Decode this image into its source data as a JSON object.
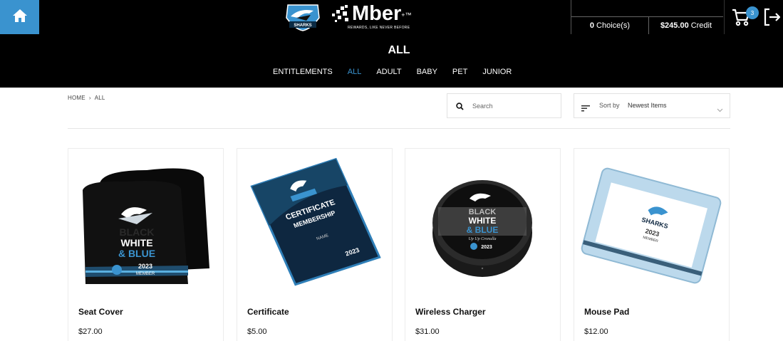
{
  "header": {
    "brand_name": "Mber",
    "brand_tm": "+™",
    "brand_tagline": "REWARDS, LIKE NEVER BEFORE",
    "shark_logo_text": "SHARKS",
    "choices_count": "0",
    "choices_label": "Choice(s)",
    "credit_amount": "$245.00",
    "credit_label": "Credit",
    "cart_count": "3",
    "accent_color": "#3a93cf"
  },
  "category": {
    "title": "ALL",
    "tabs": [
      {
        "label": "ENTITLEMENTS",
        "active": false
      },
      {
        "label": "ALL",
        "active": true
      },
      {
        "label": "ADULT",
        "active": false
      },
      {
        "label": "BABY",
        "active": false
      },
      {
        "label": "PET",
        "active": false
      },
      {
        "label": "JUNIOR",
        "active": false
      }
    ]
  },
  "breadcrumb": {
    "home": "HOME",
    "separator": "›",
    "current": "ALL"
  },
  "search": {
    "placeholder": "Search",
    "value": ""
  },
  "sort": {
    "label": "Sort by",
    "value": "Newest Items"
  },
  "products": [
    {
      "name": "Seat Cover",
      "price": "$27.00",
      "image_icon": "seat-cover-image",
      "image_text": [
        "BLACK",
        "WHITE",
        "& BLUE",
        "2023",
        "MEMBER"
      ]
    },
    {
      "name": "Certificate",
      "price": "$5.00",
      "image_icon": "certificate-image",
      "image_text": [
        "CERTIFICATE",
        "MEMBERSHIP",
        "NAME",
        "2023"
      ]
    },
    {
      "name": "Wireless Charger",
      "price": "$31.00",
      "image_icon": "wireless-charger-image",
      "image_text": [
        "BLACK",
        "WHITE",
        "& BLUE",
        "Up Up Cronulla",
        "2023"
      ]
    },
    {
      "name": "Mouse Pad",
      "price": "$12.00",
      "image_icon": "mouse-pad-image",
      "image_text": [
        "SHARKS",
        "2023",
        "MEMBER"
      ]
    }
  ]
}
